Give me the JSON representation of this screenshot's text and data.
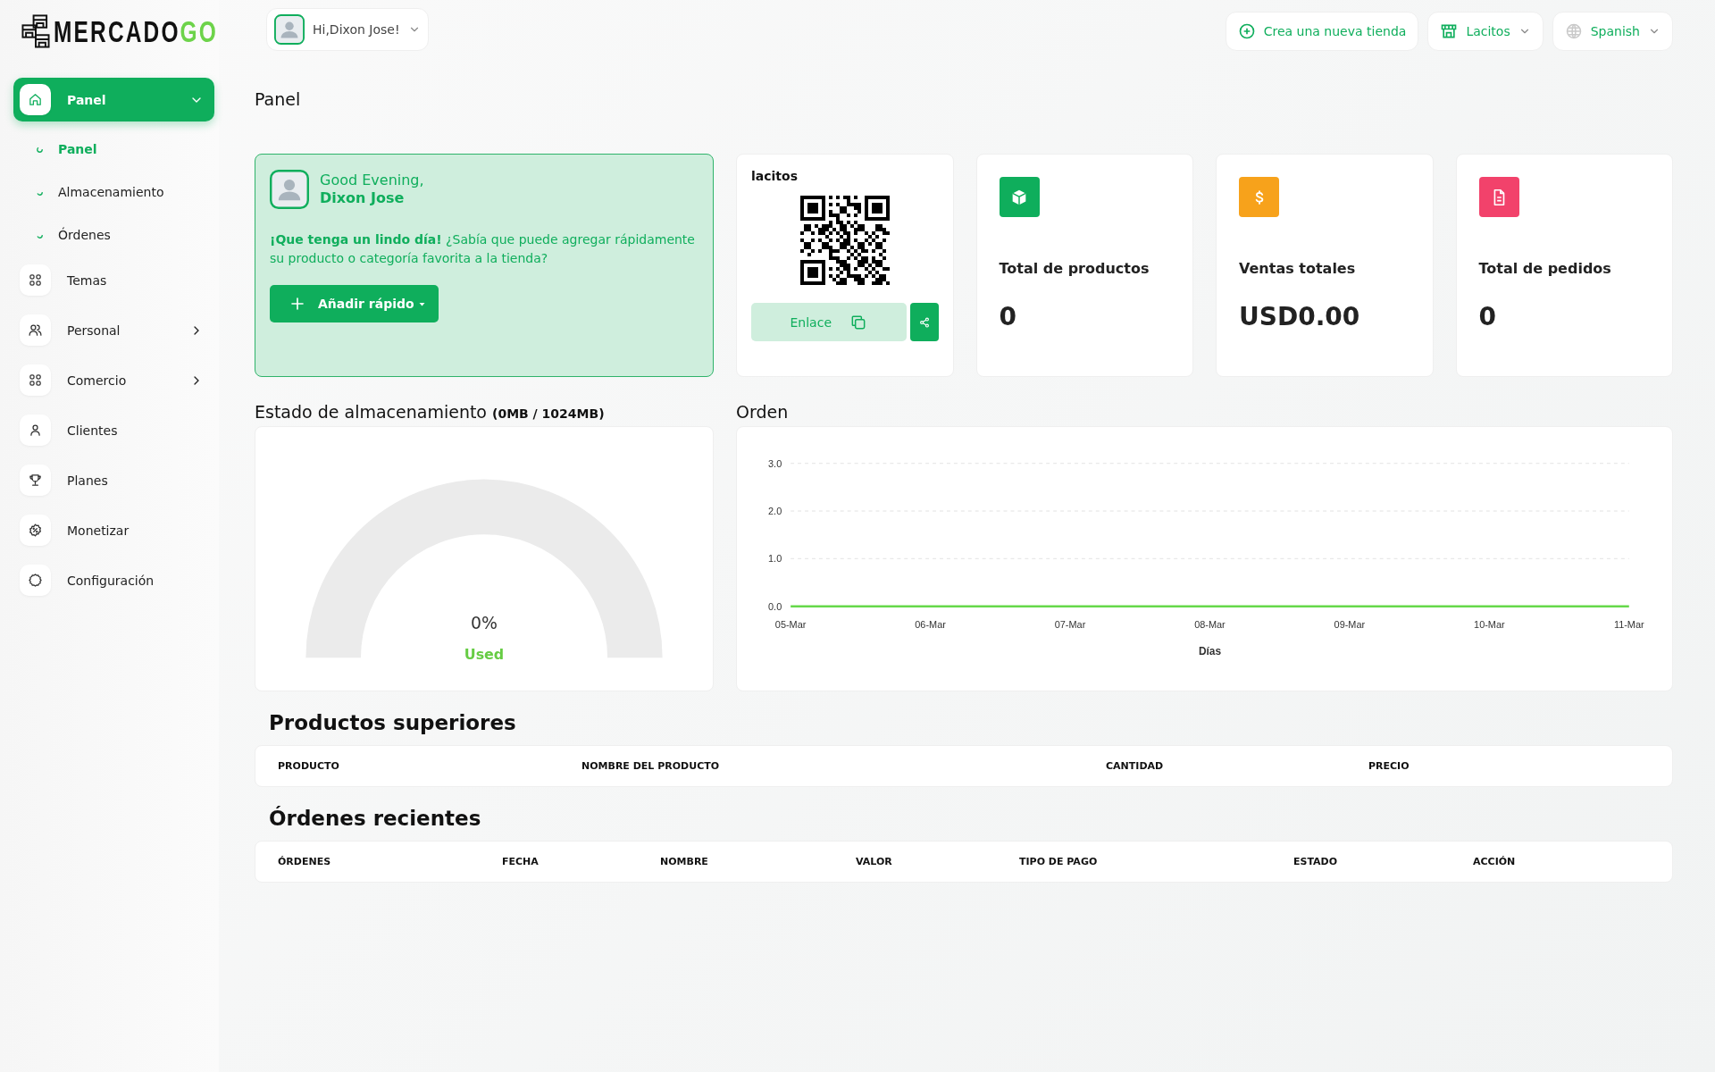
{
  "logo": {
    "text": "MERCADO",
    "accent": "GO"
  },
  "user_menu": {
    "label": "Hi,Dixon Jose!"
  },
  "header_actions": {
    "new_store": "Crea una nueva tienda",
    "store": "Lacitos",
    "language": "Spanish"
  },
  "sidebar": {
    "items": [
      {
        "label": "Panel",
        "kind": "group",
        "selected": true,
        "expanded": true,
        "children": [
          {
            "label": "Panel",
            "selected": true
          },
          {
            "label": "Almacenamiento",
            "selected": false
          },
          {
            "label": "Órdenes",
            "selected": false
          }
        ]
      },
      {
        "label": "Temas",
        "kind": "link",
        "selected": false
      },
      {
        "label": "Personal",
        "kind": "group",
        "selected": false,
        "expanded": false
      },
      {
        "label": "Comercio",
        "kind": "group",
        "selected": false,
        "expanded": false
      },
      {
        "label": "Clientes",
        "kind": "link",
        "selected": false
      },
      {
        "label": "Planes",
        "kind": "link",
        "selected": false
      },
      {
        "label": "Monetizar",
        "kind": "link",
        "selected": false
      },
      {
        "label": "Configuración",
        "kind": "link",
        "selected": false
      }
    ]
  },
  "page_title": "Panel",
  "welcome": {
    "greeting": "Good Evening,",
    "name": "Dixon Jose",
    "message": "**¡Que tenga un lindo día!** ¿Sabía que puede agregar rápidamente su producto o categoría favorita a la tienda?",
    "button": "Añadir rápido"
  },
  "store_card": {
    "name": "lacitos",
    "link_button": "Enlace"
  },
  "stats": [
    {
      "label": "Total de productos",
      "value": "0",
      "color": "#0fae5c"
    },
    {
      "label": "Ventas totales",
      "value": "USD0.00",
      "color": "#f7a21b"
    },
    {
      "label": "Total de pedidos",
      "value": "0",
      "color": "#f2426b"
    }
  ],
  "storage": {
    "title": "Estado de almacenamiento",
    "usage": "(0MB / 1024MB)",
    "percent": "0%",
    "caption": "Used"
  },
  "orders_chart": {
    "title": "Orden",
    "chart_data": {
      "type": "line",
      "xlabel": "Días",
      "categories": [
        "05-Mar",
        "06-Mar",
        "07-Mar",
        "08-Mar",
        "09-Mar",
        "10-Mar",
        "11-Mar"
      ],
      "ylim": [
        0,
        3
      ],
      "yticks": [
        {
          "value": 0,
          "label": "0.0"
        },
        {
          "value": 1,
          "label": "1.0"
        },
        {
          "value": 2,
          "label": "2.0"
        },
        {
          "value": 3,
          "label": "3.0"
        }
      ],
      "series": [
        {
          "color": "#66d94a",
          "values": [
            0,
            0,
            0,
            0,
            0,
            0,
            0
          ]
        }
      ]
    }
  },
  "top_products": {
    "title": "Productos superiores",
    "columns": [
      "PRODUCTO",
      "NOMBRE DEL PRODUCTO",
      "CANTIDAD",
      "PRECIO"
    ]
  },
  "recent_orders": {
    "title": "Órdenes recientes",
    "columns": [
      "ÓRDENES",
      "FECHA",
      "NOMBRE",
      "VALOR",
      "TIPO DE PAGO",
      "ESTADO",
      "ACCIÓN"
    ]
  }
}
